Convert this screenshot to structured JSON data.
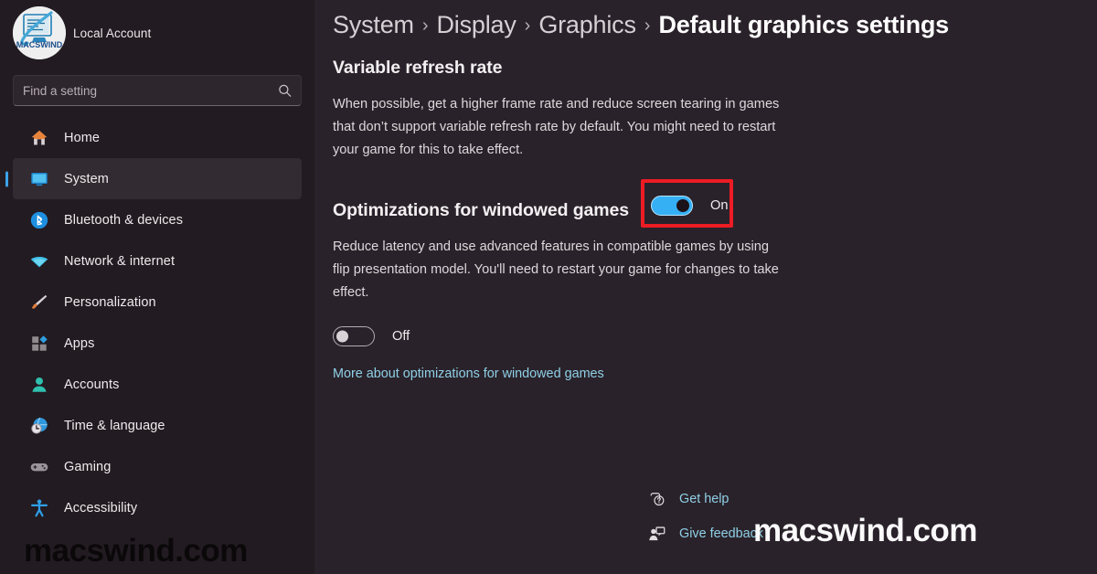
{
  "account": {
    "name": "Local Account",
    "avatar_logo_text": "MACSWIND",
    "avatar_icon": "macswind-logo-icon"
  },
  "search": {
    "placeholder": "Find a setting",
    "value": "",
    "icon": "search-icon"
  },
  "sidebar": {
    "items": [
      {
        "label": "Home",
        "icon": "home-icon",
        "selected": false
      },
      {
        "label": "System",
        "icon": "monitor-icon",
        "selected": true
      },
      {
        "label": "Bluetooth & devices",
        "icon": "bluetooth-icon",
        "selected": false
      },
      {
        "label": "Network & internet",
        "icon": "wifi-icon",
        "selected": false
      },
      {
        "label": "Personalization",
        "icon": "paintbrush-icon",
        "selected": false
      },
      {
        "label": "Apps",
        "icon": "apps-grid-icon",
        "selected": false
      },
      {
        "label": "Accounts",
        "icon": "person-icon",
        "selected": false
      },
      {
        "label": "Time & language",
        "icon": "globe-clock-icon",
        "selected": false
      },
      {
        "label": "Gaming",
        "icon": "gamepad-icon",
        "selected": false
      },
      {
        "label": "Accessibility",
        "icon": "accessibility-icon",
        "selected": false
      }
    ]
  },
  "breadcrumb": {
    "separator": "›",
    "items": [
      {
        "label": "System",
        "current": false
      },
      {
        "label": "Display",
        "current": false
      },
      {
        "label": "Graphics",
        "current": false
      },
      {
        "label": "Default graphics settings",
        "current": true
      }
    ]
  },
  "sections": {
    "variable_refresh_rate": {
      "title": "Variable refresh rate",
      "description": "When possible, get a higher frame rate and reduce screen tearing in games that don’t support variable refresh rate by default. You might need to restart your game for this to take effect.",
      "toggle_state": "On",
      "toggle_on": true,
      "highlighted": true
    },
    "optimizations_for_windowed_games": {
      "title": "Optimizations for windowed games",
      "description": "Reduce latency and use advanced features in compatible games by using flip presentation model. You'll need to restart your game for changes to take effect.",
      "toggle_state": "Off",
      "toggle_on": false,
      "link_label": "More about optimizations for windowed games"
    }
  },
  "footer": {
    "links": [
      {
        "label": "Get help",
        "icon": "help-bubble-icon"
      },
      {
        "label": "Give feedback",
        "icon": "feedback-person-icon"
      }
    ]
  },
  "watermarks": {
    "bottom_left": "macswind.com",
    "bottom_right": "macswind.com"
  },
  "colors": {
    "sidebar_bg": "#221b21",
    "content_bg": "#2a222a",
    "accent_blue": "#3ca2ea",
    "toggle_on": "#36b0f5",
    "link": "#8ed0e6",
    "highlight_box": "#ed1c24",
    "selected_item_bg": "#322b31"
  }
}
